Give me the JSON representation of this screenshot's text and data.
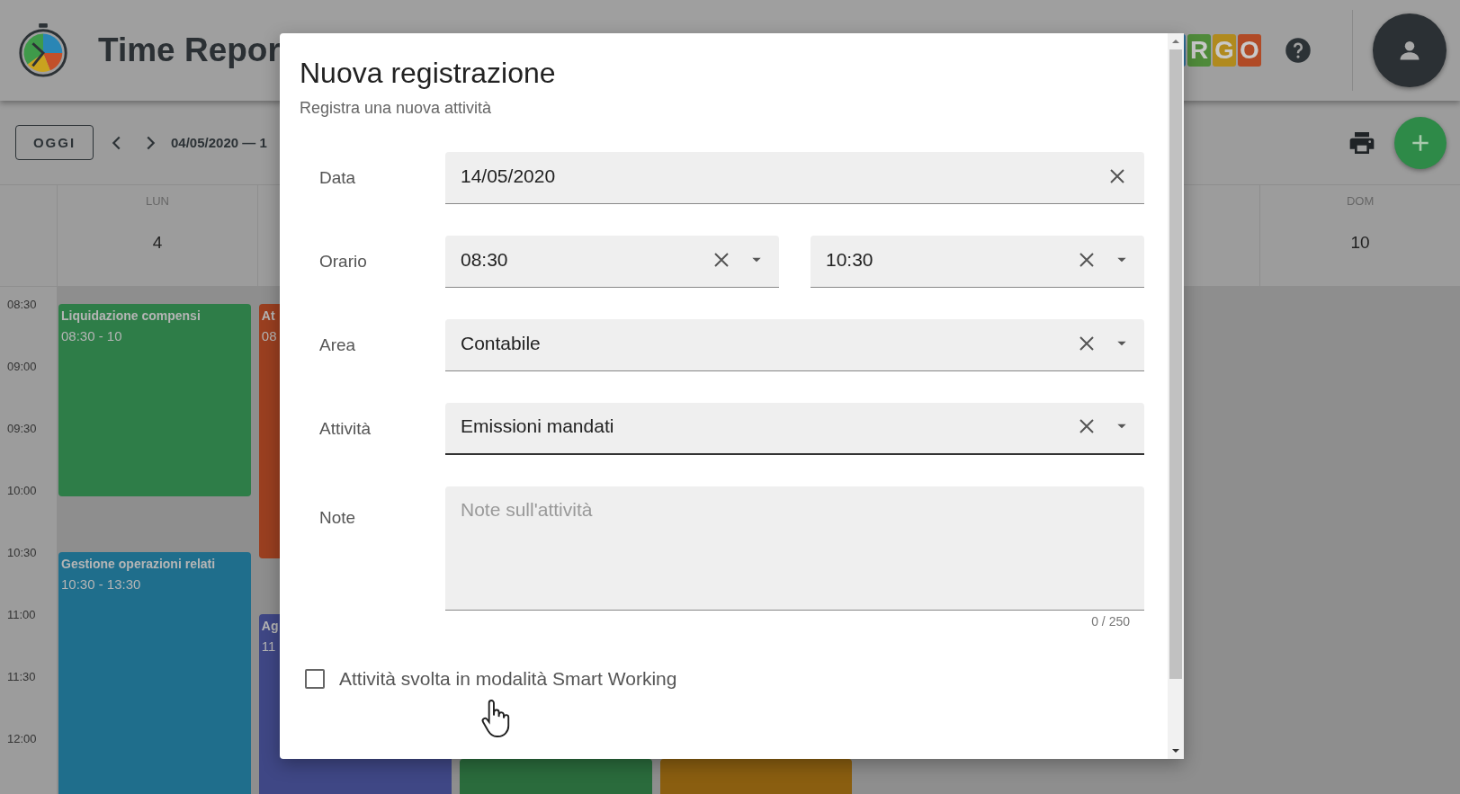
{
  "app": {
    "title": "Time Repor"
  },
  "brand_tiles": [
    {
      "color": "#2f6f9a"
    },
    {
      "letter": "R",
      "color": "#4f8a3a"
    },
    {
      "letter": "G",
      "color": "#b08a1e"
    },
    {
      "letter": "O",
      "color": "#b04a26"
    }
  ],
  "toolbar": {
    "today_button": "OGGI",
    "date_range": "04/05/2020 — 1"
  },
  "calendar": {
    "times": [
      "08:30",
      "09:00",
      "09:30",
      "10:00",
      "10:30",
      "11:00",
      "11:30",
      "12:00"
    ],
    "days": [
      {
        "kind": "dated",
        "weekday": "LUN",
        "date": "4",
        "events": [
          {
            "title": "Liquidazione compensi",
            "time": "08:30 - 10",
            "color": "#2e7d48"
          },
          {
            "title": "Gestione operazioni relati",
            "time": "10:30 - 13:30",
            "color": "#1f6e8c"
          }
        ]
      },
      {
        "kind": "plain",
        "events": [
          {
            "title": "At",
            "time": "08",
            "color": "#9a3f20"
          },
          {
            "title": "Ag",
            "time": "11",
            "color": "#3f4785"
          }
        ]
      },
      {
        "kind": "plain",
        "events": [
          {
            "color": "#2a6b3c"
          }
        ]
      },
      {
        "kind": "plain",
        "events": [
          {
            "color": "#8a5e10"
          }
        ]
      },
      {
        "kind": "plain"
      },
      {
        "kind": "plain"
      },
      {
        "kind": "dated",
        "weekday": "DOM",
        "date": "10"
      }
    ]
  },
  "dialog": {
    "title": "Nuova registrazione",
    "subtitle": "Registra una nuova attività",
    "fields": [
      {
        "label": "Data",
        "inputs": [
          {
            "kind": "date",
            "value": "14/05/2020",
            "focused": false
          }
        ]
      },
      {
        "label": "Orario",
        "inputs": [
          {
            "kind": "select",
            "value": "08:30",
            "focused": false
          },
          {
            "kind": "select",
            "value": "10:30",
            "focused": false
          }
        ]
      },
      {
        "label": "Area",
        "inputs": [
          {
            "kind": "select",
            "value": "Contabile",
            "focused": false
          }
        ]
      },
      {
        "label": "Attività",
        "inputs": [
          {
            "kind": "select",
            "value": "Emissioni mandati",
            "focused": true
          }
        ]
      }
    ],
    "note": {
      "label": "Note",
      "placeholder": "Note sull'attività",
      "counter": "0 / 250"
    },
    "smart_working": {
      "label": "Attività svolta in modalità Smart Working",
      "checked": false
    }
  }
}
